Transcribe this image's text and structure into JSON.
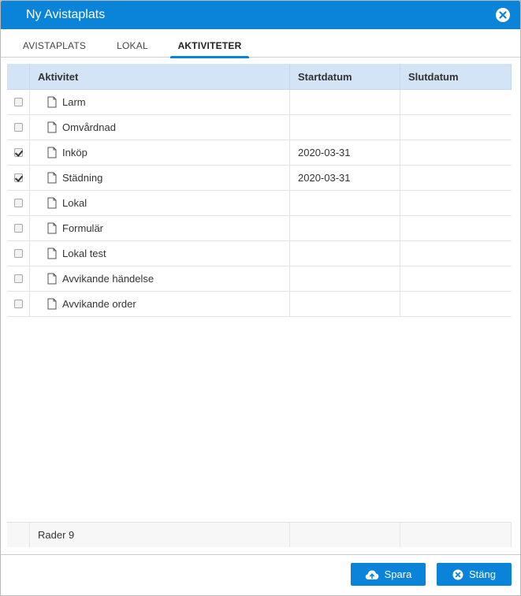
{
  "dialog": {
    "title": "Ny Avistaplats",
    "accent": "#0a84d8",
    "close_icon": "close-circle-icon"
  },
  "tabs": [
    {
      "label": "AVISTAPLATS",
      "active": false
    },
    {
      "label": "LOKAL",
      "active": false
    },
    {
      "label": "AKTIVITETER",
      "active": true
    }
  ],
  "grid": {
    "columns": {
      "name": "Aktivitet",
      "start": "Startdatum",
      "end": "Slutdatum"
    },
    "rows": [
      {
        "checked": false,
        "name": "Larm",
        "start": "",
        "end": ""
      },
      {
        "checked": false,
        "name": "Omvårdnad",
        "start": "",
        "end": ""
      },
      {
        "checked": true,
        "name": "Inköp",
        "start": "2020-03-31",
        "end": ""
      },
      {
        "checked": true,
        "name": "Städning",
        "start": "2020-03-31",
        "end": ""
      },
      {
        "checked": false,
        "name": "Lokal",
        "start": "",
        "end": ""
      },
      {
        "checked": false,
        "name": "Formulär",
        "start": "",
        "end": ""
      },
      {
        "checked": false,
        "name": "Lokal test",
        "start": "",
        "end": ""
      },
      {
        "checked": false,
        "name": "Avvikande händelse",
        "start": "",
        "end": ""
      },
      {
        "checked": false,
        "name": "Avvikande order",
        "start": "",
        "end": ""
      }
    ],
    "footer": "Rader 9"
  },
  "buttons": {
    "save_label": "Spara",
    "save_icon": "cloud-upload-icon",
    "close_label": "Stäng",
    "close_icon": "close-circle-icon"
  }
}
